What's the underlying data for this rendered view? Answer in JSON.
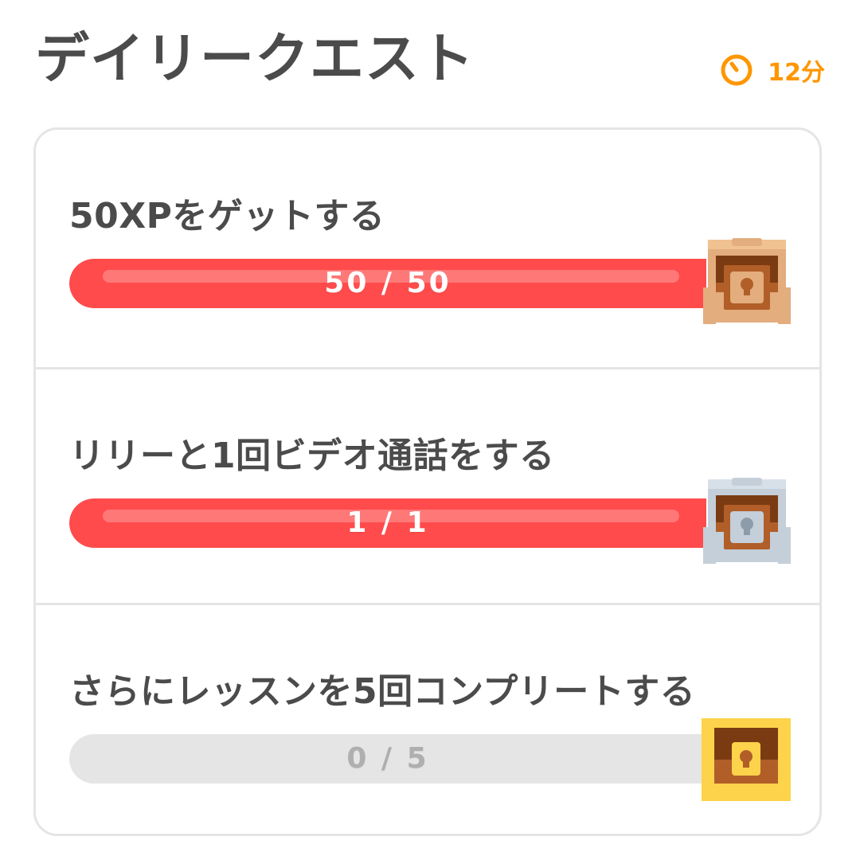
{
  "header": {
    "title": "デイリークエスト",
    "timer_text": "12分",
    "timer_icon": "timer-icon"
  },
  "colors": {
    "accent_orange": "#ff9600",
    "progress_red": "#ff4b4b",
    "track_gray": "#e5e5e5",
    "text_dark": "#4b4b4b"
  },
  "quests": [
    {
      "label": "50XPをゲットする",
      "progress_text": "50 / 50",
      "current": 50,
      "total": 50,
      "chest_icon": "bronze-chest-icon"
    },
    {
      "label": "リリーと1回ビデオ通話をする",
      "progress_text": "1 / 1",
      "current": 1,
      "total": 1,
      "chest_icon": "silver-chest-icon"
    },
    {
      "label": "さらにレッスンを5回コンプリートする",
      "progress_text": "0 / 5",
      "current": 0,
      "total": 5,
      "chest_icon": "gold-chest-icon"
    }
  ]
}
